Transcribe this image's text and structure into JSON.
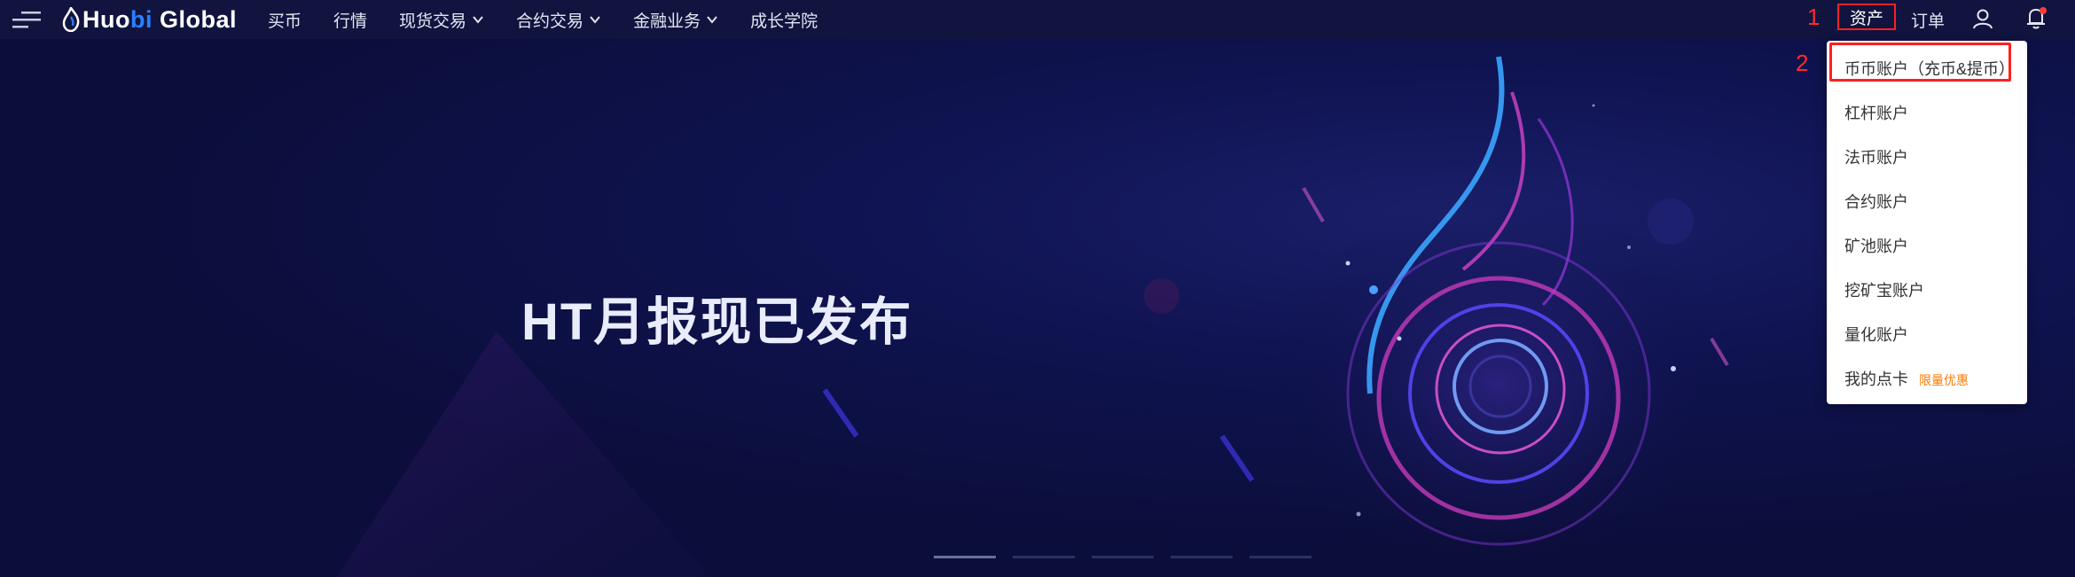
{
  "header": {
    "logo_huo": "Huo",
    "logo_bi": "bi",
    "logo_global": " Global",
    "nav": [
      {
        "label": "买币",
        "dropdown": false
      },
      {
        "label": "行情",
        "dropdown": false
      },
      {
        "label": "现货交易",
        "dropdown": true
      },
      {
        "label": "合约交易",
        "dropdown": true
      },
      {
        "label": "金融业务",
        "dropdown": true
      },
      {
        "label": "成长学院",
        "dropdown": false
      }
    ],
    "marker1": "1",
    "marker2": "2",
    "assets_label": "资产",
    "orders_label": "订单"
  },
  "hero": {
    "title": "HT月报现已发布"
  },
  "dropdown": {
    "items": [
      {
        "label": "币币账户（充币&提币）"
      },
      {
        "label": "杠杆账户"
      },
      {
        "label": "法币账户"
      },
      {
        "label": "合约账户"
      },
      {
        "label": "矿池账户"
      },
      {
        "label": "挖矿宝账户"
      },
      {
        "label": "量化账户"
      },
      {
        "label": "我的点卡",
        "tag": "限量优惠"
      }
    ]
  },
  "colors": {
    "header_bg": "#10143e",
    "hero_bg": "#0b0e3a",
    "highlight_red": "#ff2020",
    "tag_orange": "#ff7a00",
    "brand_blue": "#2a7fff"
  },
  "carousel": {
    "count": 5,
    "active_index": 0
  }
}
